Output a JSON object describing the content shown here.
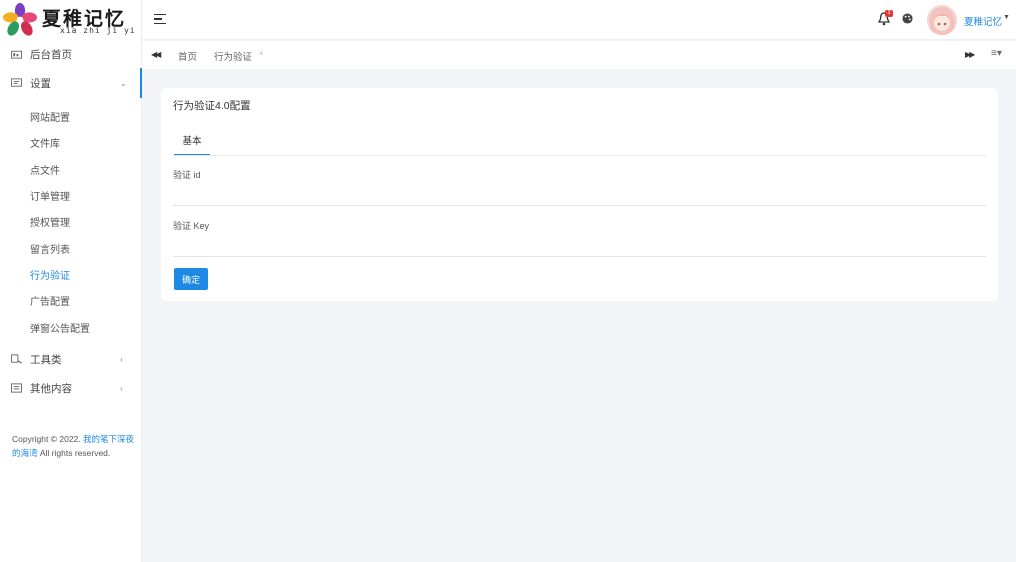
{
  "brand": {
    "title": "夏稚记忆",
    "pinyin": "xia zhi ji yi"
  },
  "sidebar": {
    "items": [
      {
        "label": "后台首页",
        "icon": "dashboard-icon"
      },
      {
        "label": "设置",
        "icon": "settings-panel-icon",
        "expanded": true
      },
      {
        "label": "工具类",
        "icon": "tools-icon",
        "expanded": false
      },
      {
        "label": "其他内容",
        "icon": "list-icon",
        "expanded": false
      }
    ],
    "settings_children": [
      {
        "label": "网站配置"
      },
      {
        "label": "文件库"
      },
      {
        "label": "点文件"
      },
      {
        "label": "订单管理"
      },
      {
        "label": "授权管理"
      },
      {
        "label": "留言列表"
      },
      {
        "label": "行为验证",
        "active": true
      },
      {
        "label": "广告配置"
      },
      {
        "label": "弹窗公告配置"
      }
    ],
    "copyright": {
      "prefix": "Copyright © 2022. ",
      "link": "我的笔下深夜的海湾",
      "suffix": " All rights reserved."
    }
  },
  "topbar": {
    "notification_count": "3",
    "username": "夏稚记忆"
  },
  "tabs": [
    {
      "label": "首页"
    },
    {
      "label": "行为验证",
      "active": true
    }
  ],
  "page": {
    "title": "行为验证4.0配置",
    "subtab": "基本",
    "fields": [
      {
        "label": "验证 id",
        "value": "",
        "placeholder": ""
      },
      {
        "label": "验证 Key",
        "value": "",
        "placeholder": ""
      }
    ],
    "submit_label": "确定"
  },
  "colors": {
    "accent": "#1e88e5",
    "badge": "#e53935",
    "background": "#f2f4f8"
  }
}
